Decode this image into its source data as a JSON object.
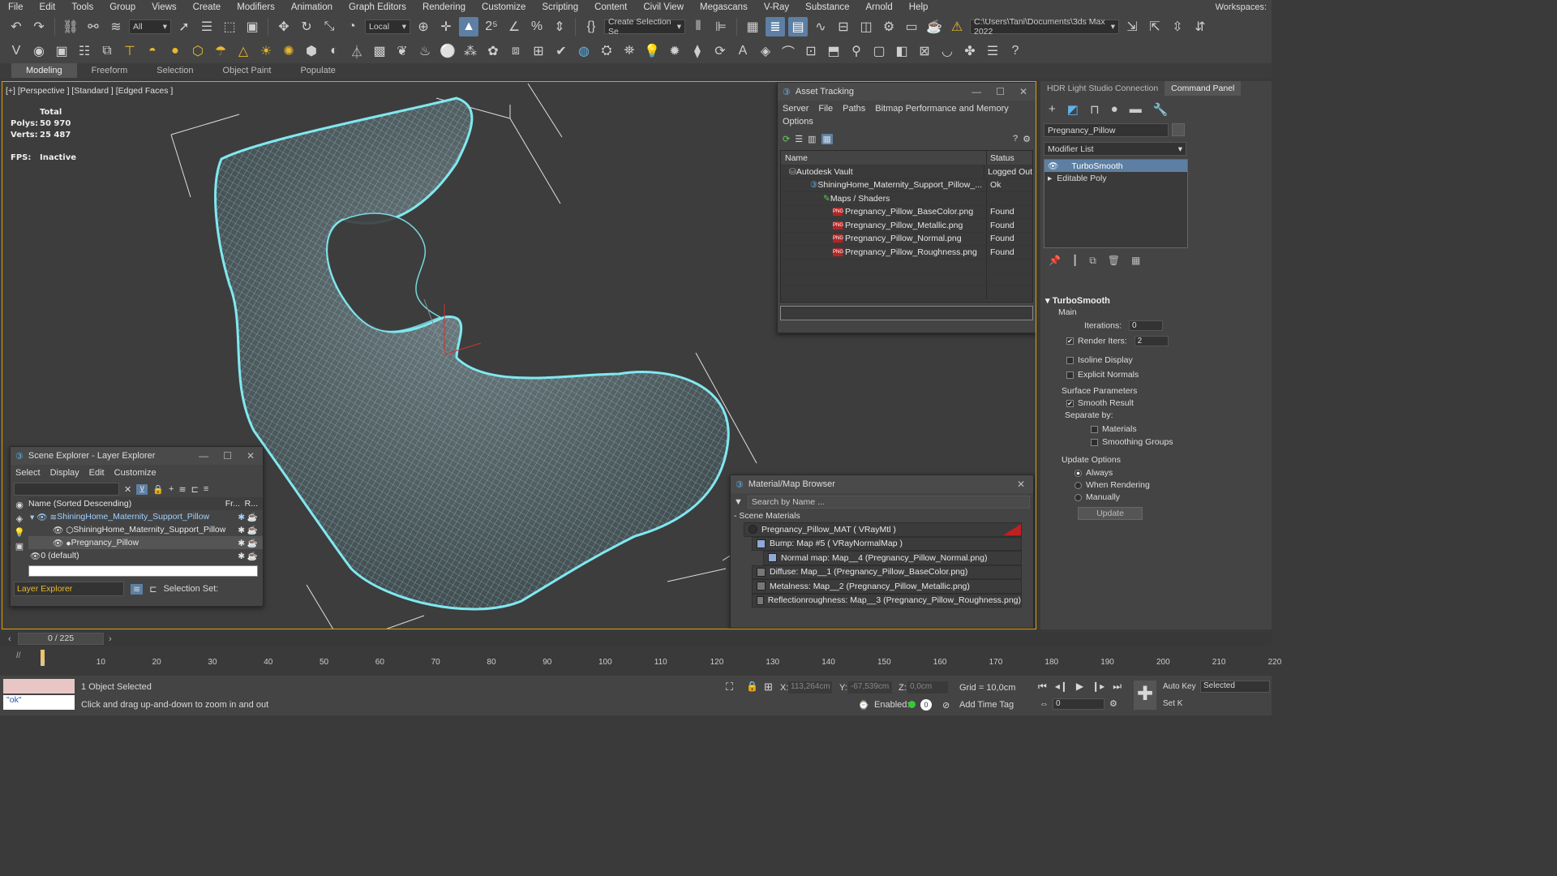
{
  "menu": [
    "File",
    "Edit",
    "Tools",
    "Group",
    "Views",
    "Create",
    "Modifiers",
    "Animation",
    "Graph Editors",
    "Rendering",
    "Customize",
    "Scripting",
    "Content",
    "Civil View",
    "Megascans",
    "V-Ray",
    "Substance",
    "Arnold",
    "Help"
  ],
  "workspaces_label": "Workspaces:",
  "toolbar": {
    "filter_value": "All",
    "coord_value": "Local",
    "selection_set": "Create Selection Se",
    "project_path": "C:\\Users\\Tani\\Documents\\3ds Max 2022"
  },
  "ribbon_tabs": [
    "Modeling",
    "Freeform",
    "Selection",
    "Object Paint",
    "Populate"
  ],
  "viewport": {
    "label": "[+] [Perspective ] [Standard ] [Edged Faces ]",
    "stats_total": "Total",
    "polys_label": "Polys:",
    "polys_value": "50 970",
    "verts_label": "Verts:",
    "verts_value": "25 487",
    "fps_label": "FPS:",
    "fps_value": "Inactive"
  },
  "asset_tracking": {
    "title": "Asset Tracking",
    "menu": [
      "Server",
      "File",
      "Paths",
      "Bitmap Performance and Memory"
    ],
    "menu2": "Options",
    "col_name": "Name",
    "col_status": "Status",
    "rows": [
      {
        "name": "Autodesk Vault",
        "status": "Logged Out"
      },
      {
        "name": "ShiningHome_Maternity_Support_Pillow_...",
        "status": "Ok"
      },
      {
        "name": "Maps / Shaders",
        "status": ""
      },
      {
        "name": "Pregnancy_Pillow_BaseColor.png",
        "status": "Found"
      },
      {
        "name": "Pregnancy_Pillow_Metallic.png",
        "status": "Found"
      },
      {
        "name": "Pregnancy_Pillow_Normal.png",
        "status": "Found"
      },
      {
        "name": "Pregnancy_Pillow_Roughness.png",
        "status": "Found"
      }
    ]
  },
  "command_panel": {
    "tabs": [
      "HDR Light Studio Connection",
      "Command Panel"
    ],
    "object_name": "Pregnancy_Pillow",
    "modifier_list": "Modifier List",
    "stack": [
      "TurboSmooth",
      "Editable Poly"
    ],
    "rollout_title": "TurboSmooth",
    "main_label": "Main",
    "iterations_label": "Iterations:",
    "iterations_value": "0",
    "render_iters_label": "Render Iters:",
    "render_iters_value": "2",
    "isoline_label": "Isoline Display",
    "explicit_normals_label": "Explicit Normals",
    "surface_params_label": "Surface Parameters",
    "smooth_result_label": "Smooth Result",
    "separate_by_label": "Separate by:",
    "materials_label": "Materials",
    "smoothing_groups_label": "Smoothing Groups",
    "update_options_label": "Update Options",
    "always_label": "Always",
    "when_rendering_label": "When Rendering",
    "manually_label": "Manually",
    "update_button": "Update"
  },
  "scene_explorer": {
    "title": "Scene Explorer - Layer Explorer",
    "menu": [
      "Select",
      "Display",
      "Edit",
      "Customize"
    ],
    "col_name": "Name (Sorted Descending)",
    "col_fr": "Fr...",
    "col_r": "R...",
    "rows": [
      "ShiningHome_Maternity_Support_Pillow",
      "ShiningHome_Maternity_Support_Pillow",
      "Pregnancy_Pillow",
      "0 (default)"
    ],
    "footer_dropdown": "Layer Explorer",
    "selection_set": "Selection Set:"
  },
  "material_browser": {
    "title": "Material/Map Browser",
    "search_placeholder": "Search by Name ...",
    "section": "- Scene Materials",
    "rows": [
      "Pregnancy_Pillow_MAT  ( VRayMtl )",
      "Bump: Map #5  ( VRayNormalMap )",
      "Normal map: Map__4 (Pregnancy_Pillow_Normal.png)",
      "Diffuse: Map__1 (Pregnancy_Pillow_BaseColor.png)",
      "Metalness: Map__2 (Pregnancy_Pillow_Metallic.png)",
      "Reflectionroughness: Map__3 (Pregnancy_Pillow_Roughness.png)"
    ]
  },
  "timeline": {
    "frame": "0 / 225",
    "ticks": [
      "0",
      "10",
      "20",
      "30",
      "40",
      "50",
      "60",
      "70",
      "80",
      "90",
      "100",
      "110",
      "120",
      "130",
      "140",
      "150",
      "160",
      "170",
      "180",
      "190",
      "200",
      "210",
      "220"
    ]
  },
  "status": {
    "maxscript": "\"ok\"",
    "selected": "1 Object Selected",
    "prompt": "Click and drag up-and-down to zoom in and out",
    "x_label": "X:",
    "x_value": "113,264cm",
    "y_label": "Y:",
    "y_value": "-67,539cm",
    "z_label": "Z:",
    "z_value": "0,0cm",
    "grid": "Grid = 10,0cm",
    "enabled_label": "Enabled:",
    "add_time_tag": "Add Time Tag",
    "auto_key": "Auto Key",
    "set_key": "Set K",
    "selected_dropdown": "Selected",
    "frame_value": "0"
  },
  "colors": {
    "wire": "#7fe8f0",
    "selection_border": "#e0a000",
    "highlight": "#5d7fa3"
  }
}
